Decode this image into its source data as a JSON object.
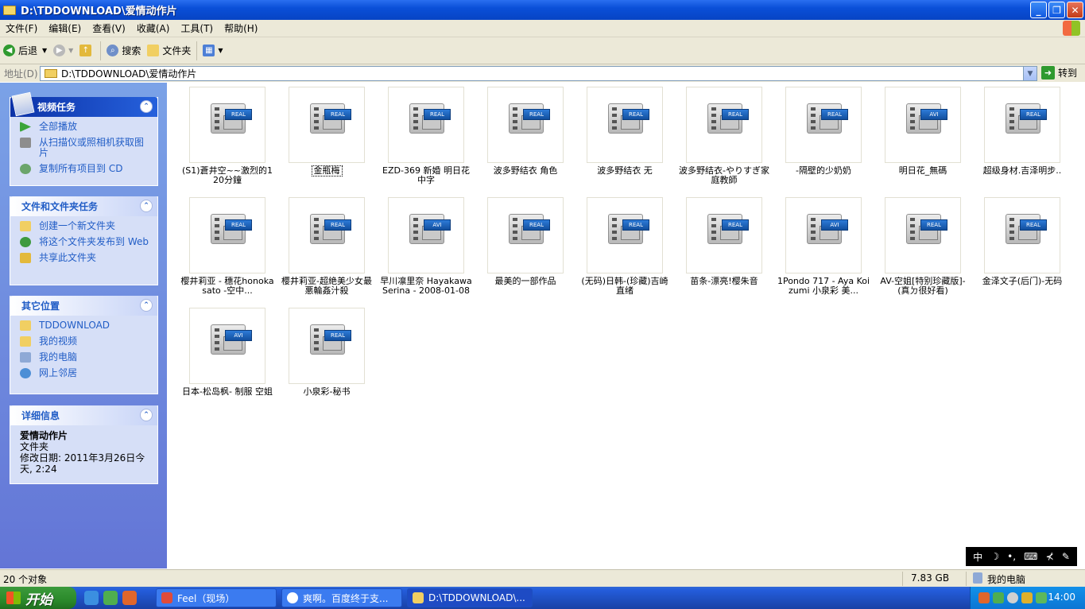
{
  "window": {
    "title": "D:\\TDDOWNLOAD\\爱情动作片",
    "buttons": [
      "_",
      "❐",
      "✕"
    ]
  },
  "menu": [
    "文件(F)",
    "编辑(E)",
    "查看(V)",
    "收藏(A)",
    "工具(T)",
    "帮助(H)"
  ],
  "toolbar": {
    "back": "后退",
    "search": "搜索",
    "folders": "文件夹"
  },
  "address": {
    "label": "地址(D)",
    "value": "D:\\TDDOWNLOAD\\爱情动作片",
    "go": "转到"
  },
  "tasks": {
    "video": {
      "title": "视频任务",
      "items": [
        "全部播放",
        "从扫描仪或照相机获取图片",
        "复制所有项目到 CD"
      ]
    },
    "file": {
      "title": "文件和文件夹任务",
      "items": [
        "创建一个新文件夹",
        "将这个文件夹发布到 Web",
        "共享此文件夹"
      ]
    },
    "other": {
      "title": "其它位置",
      "items": [
        "TDDOWNLOAD",
        "我的视频",
        "我的电脑",
        "网上邻居"
      ]
    },
    "details": {
      "title": "详细信息",
      "name": "爱情动作片",
      "type": "文件夹",
      "modified": "修改日期: 2011年3月26日今天, 2:24"
    }
  },
  "files": [
    {
      "name": "(S1)蒼井空~~激烈的120分鐘",
      "badge": "REAL"
    },
    {
      "name": "金瓶梅",
      "badge": "REAL"
    },
    {
      "name": "EZD-369 新婚 明日花中字",
      "badge": "REAL"
    },
    {
      "name": "波多野结衣 角色",
      "badge": "REAL"
    },
    {
      "name": "波多野结衣 无",
      "badge": "REAL"
    },
    {
      "name": "波多野结衣-やりすぎ家庭教師",
      "badge": "REAL"
    },
    {
      "name": "-隔壁的少奶奶",
      "badge": "REAL"
    },
    {
      "name": "明日花_無碼",
      "badge": "AVI"
    },
    {
      "name": "超级身材.吉泽明步..",
      "badge": "REAL"
    },
    {
      "name": "樱井莉亚 - 穗花honoka sato -空中...",
      "badge": "REAL"
    },
    {
      "name": "樱井莉亚-超絶美少女最悪輪姦汁殺",
      "badge": "REAL"
    },
    {
      "name": "早川凛里奈 Hayakawa Serina - 2008-01-08 ...",
      "badge": "AVI"
    },
    {
      "name": "最美的一部作品",
      "badge": "REAL"
    },
    {
      "name": "(无码)日韩-(珍藏)吉崎直绪",
      "badge": "REAL"
    },
    {
      "name": "苗条-漂亮!樱朱音",
      "badge": "REAL"
    },
    {
      "name": "1Pondo 717 - Aya Koizumi 小泉彩 美...",
      "badge": "AVI"
    },
    {
      "name": "AV-空姐[特别珍藏版]-(真ㄉ很好看)",
      "badge": "REAL"
    },
    {
      "name": "金泽文子(后门)-无码",
      "badge": "REAL"
    },
    {
      "name": "日本-松岛枫- 制服 空姐",
      "badge": "AVI"
    },
    {
      "name": "小泉彩-秘书",
      "badge": "REAL"
    }
  ],
  "ime": [
    "中",
    "☽",
    "•,",
    "⌨",
    "⊀",
    "✎"
  ],
  "status": {
    "count": "20 个对象",
    "size": "7.83 GB",
    "location": "我的电脑"
  },
  "taskbar": {
    "start": "开始",
    "tasks": [
      "Feel（现场）",
      "爽啊。百度终于支...",
      "D:\\TDDOWNLOAD\\..."
    ],
    "clock": "14:00"
  },
  "colors": {
    "accent": "#0a4fd8",
    "pane": "#6375d6",
    "link": "#215dc6"
  }
}
